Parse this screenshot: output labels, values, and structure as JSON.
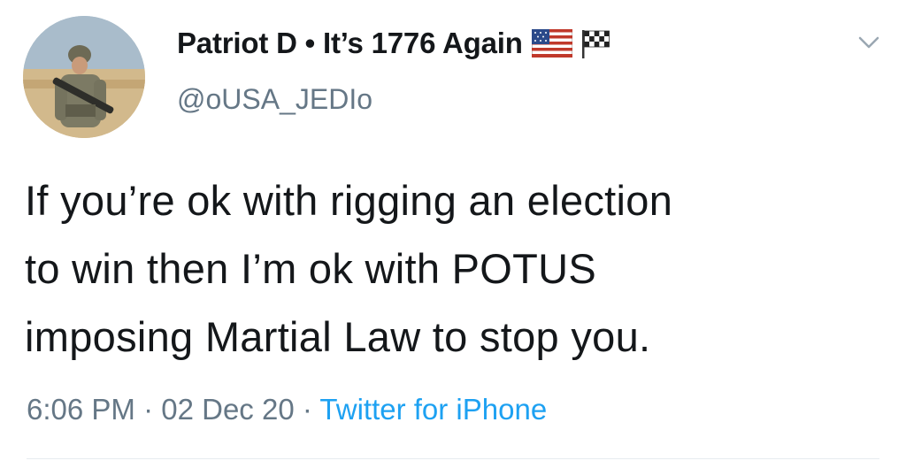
{
  "user": {
    "display_name": "Patriot D • It’s 1776 Again",
    "handle": "@oUSA_JEDIo",
    "name_icons": [
      "us-flag-icon",
      "checkered-flag-icon"
    ]
  },
  "tweet": {
    "text_lines": [
      "If you’re ok with rigging an election",
      "to win then I’m ok with POTUS",
      "imposing Martial Law to stop you."
    ],
    "time": "6:06 PM",
    "separator": " · ",
    "date": "02 Dec 20",
    "source": "Twitter for iPhone"
  },
  "menu": {
    "icon": "chevron-down-icon"
  },
  "colors": {
    "text": "#14171a",
    "secondary": "#657786",
    "link": "#1da1f2",
    "divider": "#e6ecf0"
  }
}
